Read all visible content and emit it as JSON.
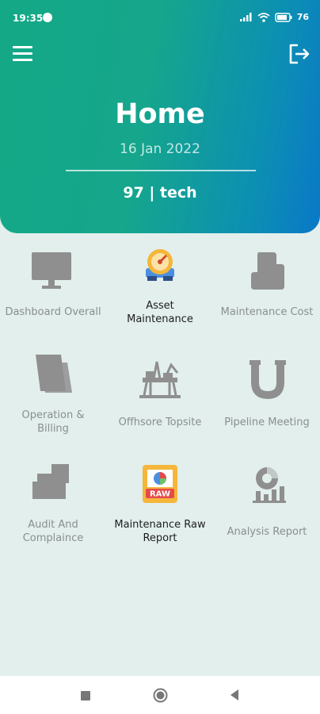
{
  "status_bar": {
    "time": "19:35",
    "battery": "76"
  },
  "header": {
    "title": "Home",
    "date": "16 Jan 2022",
    "user": "97 | tech"
  },
  "icons": {
    "menu": "hamburger-menu-icon",
    "logout": "logout-icon"
  },
  "tiles": [
    {
      "label": "Dashboard Overall",
      "icon": "monitor-icon",
      "active": false
    },
    {
      "label": "Asset Maintenance",
      "icon": "gauge-icon",
      "active": true
    },
    {
      "label": "Maintenance Cost",
      "icon": "cost-icon",
      "active": false
    },
    {
      "label": "Operation & Billing",
      "icon": "billing-icon",
      "active": false
    },
    {
      "label": "Offhsore Topsite",
      "icon": "offshore-rig-icon",
      "active": false
    },
    {
      "label": "Pipeline Meeting",
      "icon": "pipeline-icon",
      "active": false
    },
    {
      "label": "Audit And Complaince",
      "icon": "audit-icon",
      "active": false
    },
    {
      "label": "Maintenance Raw Report",
      "icon": "raw-report-icon",
      "active": true
    },
    {
      "label": "Analysis Report",
      "icon": "analysis-chart-icon",
      "active": false
    }
  ],
  "colors": {
    "header_start": "#14a886",
    "header_end": "#0a78c8",
    "background": "#e2efec",
    "inactive_icon": "#8f8f8f"
  }
}
